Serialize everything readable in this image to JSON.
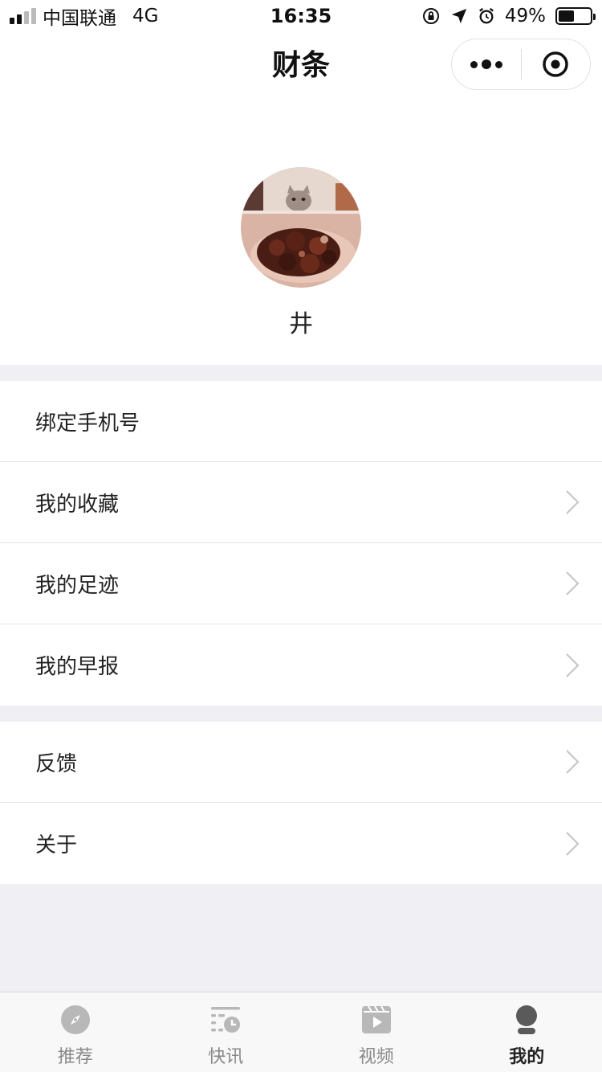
{
  "status_bar": {
    "carrier": "中国联通",
    "network": "4G",
    "time": "16:35",
    "battery_percent": "49%",
    "battery_level": 0.49
  },
  "nav": {
    "title": "财条"
  },
  "profile": {
    "username": "井"
  },
  "menu": {
    "group1": [
      {
        "label": "绑定手机号",
        "icon": "none",
        "has_chevron": false
      },
      {
        "label": "我的收藏",
        "icon": "chevron-right-icon",
        "has_chevron": true
      },
      {
        "label": "我的足迹",
        "icon": "chevron-right-icon",
        "has_chevron": true
      },
      {
        "label": "我的早报",
        "icon": "chevron-right-icon",
        "has_chevron": true
      }
    ],
    "group2": [
      {
        "label": "反馈",
        "icon": "chevron-right-icon",
        "has_chevron": true
      },
      {
        "label": "关于",
        "icon": "chevron-right-icon",
        "has_chevron": true
      }
    ]
  },
  "tab_bar": {
    "tabs": [
      {
        "label": "推荐",
        "icon": "compass-icon",
        "active": false
      },
      {
        "label": "快讯",
        "icon": "newsflash-icon",
        "active": false
      },
      {
        "label": "视频",
        "icon": "video-icon",
        "active": false
      },
      {
        "label": "我的",
        "icon": "profile-icon",
        "active": true
      }
    ]
  },
  "colors": {
    "background": "#efeff4",
    "active_tab": "#222222",
    "inactive_tab": "#888888"
  }
}
